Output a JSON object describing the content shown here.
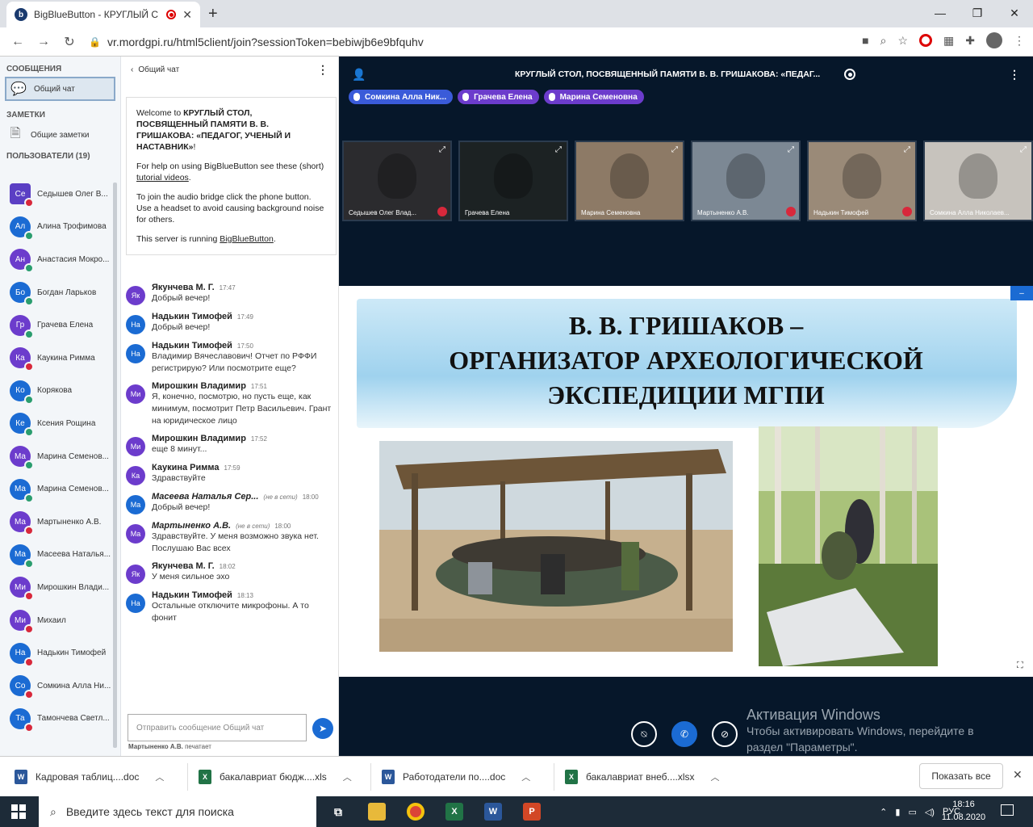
{
  "browser": {
    "tab_title": "BigBlueButton - КРУГЛЫЙ С",
    "tab_favicon": "b",
    "url": "vr.mordgpi.ru/html5client/join?sessionToken=bebiwjb6e9bfquhv"
  },
  "sidebar": {
    "messages_header": "СООБЩЕНИЯ",
    "public_chat": "Общий чат",
    "notes_header": "ЗАМЕТКИ",
    "shared_notes": "Общие заметки",
    "users_header": "ПОЛЬЗОВАТЕЛИ (19)",
    "users": [
      {
        "initials": "Се",
        "name": "Седышев Олег В...",
        "color": "#5b3fc4",
        "mic": "#d8283b",
        "square": true
      },
      {
        "initials": "Ал",
        "name": "Алина Трофимова",
        "color": "#1b6bd3",
        "mic": "#2a9d6e",
        "square": false
      },
      {
        "initials": "Ан",
        "name": "Анастасия Мокро...",
        "color": "#6c3ccc",
        "mic": "#2a9d6e",
        "square": false
      },
      {
        "initials": "Бо",
        "name": "Богдан Ларьков",
        "color": "#1b6bd3",
        "mic": "#2a9d6e",
        "square": false
      },
      {
        "initials": "Гр",
        "name": "Грачева Елена",
        "color": "#6c3ccc",
        "mic": "#2a9d6e",
        "square": false
      },
      {
        "initials": "Ка",
        "name": "Каукина Римма",
        "color": "#6c3ccc",
        "mic": "#d8283b",
        "square": false
      },
      {
        "initials": "Ко",
        "name": "Корякова",
        "color": "#1b6bd3",
        "mic": "#2a9d6e",
        "square": false
      },
      {
        "initials": "Ке",
        "name": "Ксения Рощина",
        "color": "#1b6bd3",
        "mic": "#2a9d6e",
        "square": false
      },
      {
        "initials": "Ма",
        "name": "Марина Семенов...",
        "color": "#6c3ccc",
        "mic": "#2a9d6e",
        "square": false
      },
      {
        "initials": "Ма",
        "name": "Марина Семенов...",
        "color": "#1b6bd3",
        "mic": "#2a9d6e",
        "square": false
      },
      {
        "initials": "Ма",
        "name": "Мартыненко А.В.",
        "color": "#6c3ccc",
        "mic": "#d8283b",
        "square": false
      },
      {
        "initials": "Ма",
        "name": "Масеева Наталья...",
        "color": "#1b6bd3",
        "mic": "#2a9d6e",
        "square": false
      },
      {
        "initials": "Ми",
        "name": "Мирошкин Влади...",
        "color": "#6c3ccc",
        "mic": "#d8283b",
        "square": false
      },
      {
        "initials": "Ми",
        "name": "Михаил",
        "color": "#6c3ccc",
        "mic": "#d8283b",
        "square": false
      },
      {
        "initials": "На",
        "name": "Надькин Тимофей",
        "color": "#1b6bd3",
        "mic": "#d8283b",
        "square": false
      },
      {
        "initials": "Со",
        "name": "Сомкина Алла Ни...",
        "color": "#1b6bd3",
        "mic": "#d8283b",
        "square": false
      },
      {
        "initials": "Та",
        "name": "Тамончева Светл...",
        "color": "#1b6bd3",
        "mic": "#d8283b",
        "square": false
      }
    ]
  },
  "chat": {
    "back_label": "Общий чат",
    "welcome_prefix": "Welcome to ",
    "meeting_name": "КРУГЛЫЙ СТОЛ, ПОСВЯЩЕННЫЙ ПАМЯТИ В. В. ГРИШАКОВА: «ПЕДАГОГ, УЧЕНЫЙ И НАСТАВНИК»",
    "welcome_suffix": "!",
    "help_text": "For help on using BigBlueButton see these (short) ",
    "help_link": "tutorial videos",
    "help_end": ".",
    "audio_text": "To join the audio bridge click the phone button. Use a headset to avoid causing background noise for others.",
    "server_text": "This server is running ",
    "server_link": "BigBlueButton",
    "server_end": ".",
    "messages": [
      {
        "initials": "Як",
        "color": "#6c3ccc",
        "name": "Якунчева М. Г.",
        "time": "17:47",
        "text": "Добрый вечер!",
        "offline": ""
      },
      {
        "initials": "На",
        "color": "#1b6bd3",
        "name": "Надькин Тимофей",
        "time": "17:49",
        "text": "Добрый вечер!",
        "offline": ""
      },
      {
        "initials": "На",
        "color": "#1b6bd3",
        "name": "Надькин Тимофей",
        "time": "17:50",
        "text": "Владимир Вячеславович! Отчет по РФФИ регистрирую? Или посмотрите еще?",
        "offline": ""
      },
      {
        "initials": "Ми",
        "color": "#6c3ccc",
        "name": "Мирошкин Владимир",
        "time": "17:51",
        "text": "Я, конечно, посмотрю, но пусть еще, как минимум, посмотрит Петр Васильевич. Грант на юридическое лицо",
        "offline": ""
      },
      {
        "initials": "Ми",
        "color": "#6c3ccc",
        "name": "Мирошкин Владимир",
        "time": "17:52",
        "text": "еще 8 минут...",
        "offline": ""
      },
      {
        "initials": "Ка",
        "color": "#6c3ccc",
        "name": "Каукина Римма",
        "time": "17:59",
        "text": "Здравствуйте",
        "offline": ""
      },
      {
        "initials": "Ма",
        "color": "#1b6bd3",
        "name": "Масеева Наталья Сер...",
        "time": "18:00",
        "text": "Добрый вечер!",
        "offline": "(не в сети)"
      },
      {
        "initials": "Ма",
        "color": "#6c3ccc",
        "name": "Мартыненко А.В.",
        "time": "18:00",
        "text": "Здравствуйте. У меня возможно звука нет. Послушаю Вас всех",
        "offline": "(не в сети)"
      },
      {
        "initials": "Як",
        "color": "#6c3ccc",
        "name": "Якунчева М. Г.",
        "time": "18:02",
        "text": "У меня сильное эхо",
        "offline": ""
      },
      {
        "initials": "На",
        "color": "#1b6bd3",
        "name": "Надькин Тимофей",
        "time": "18:13",
        "text": "Остальные отключите микрофоны. А то фонит",
        "offline": ""
      }
    ],
    "input_placeholder": "Отправить сообщение Общий чат",
    "typing_name": "Мартыненко А.В.",
    "typing_suffix": " печатает"
  },
  "main": {
    "title": "КРУГЛЫЙ СТОЛ, ПОСВЯЩЕННЫЙ ПАМЯТИ В. В. ГРИШАКОВА: «ПЕДАГ...",
    "talkers": [
      {
        "name": "Сомкина Алла Ник...",
        "color": "#3a5bd9"
      },
      {
        "name": "Грачева Елена",
        "color": "#6c3ccc"
      },
      {
        "name": "Марина Семеновна",
        "color": "#6c3ccc"
      }
    ],
    "videos": [
      {
        "name": "Седышев Олег Влад...",
        "muted": true,
        "bg": "#2b2b2e"
      },
      {
        "name": "Грачева Елена",
        "muted": false,
        "bg": "#1c2223"
      },
      {
        "name": "Марина Семеновна",
        "muted": false,
        "bg": "#8d7a66"
      },
      {
        "name": "Мартыненко А.В.",
        "muted": true,
        "bg": "#7c8894"
      },
      {
        "name": "Надькин Тимофей",
        "muted": true,
        "bg": "#9a8a78"
      },
      {
        "name": "Сомкина Алла Николаев...",
        "muted": false,
        "bg": "#c7c3bd"
      }
    ],
    "slide_title_line1": "В. В. ГРИШАКОВ –",
    "slide_title_line2": "ОРГАНИЗАТОР АРХЕОЛОГИЧЕСКОЙ",
    "slide_title_line3": "ЭКСПЕДИЦИИ МГПИ",
    "watermark_line1": "Активация Windows",
    "watermark_line2": "Чтобы активировать Windows, перейдите в",
    "watermark_line3": "раздел \"Параметры\"."
  },
  "downloads": {
    "items": [
      {
        "name": "Кадровая таблиц....doc",
        "type": "W",
        "color": "#2b579a"
      },
      {
        "name": "бакалавриат бюдж....xls",
        "type": "X",
        "color": "#217346"
      },
      {
        "name": "Работодатели по....doc",
        "type": "W",
        "color": "#2b579a"
      },
      {
        "name": "бакалавриат внеб....xlsx",
        "type": "X",
        "color": "#217346"
      }
    ],
    "show_all": "Показать все"
  },
  "taskbar": {
    "search_placeholder": "Введите здесь текст для поиска",
    "lang": "РУС",
    "time": "18:16",
    "date": "11.08.2020"
  }
}
